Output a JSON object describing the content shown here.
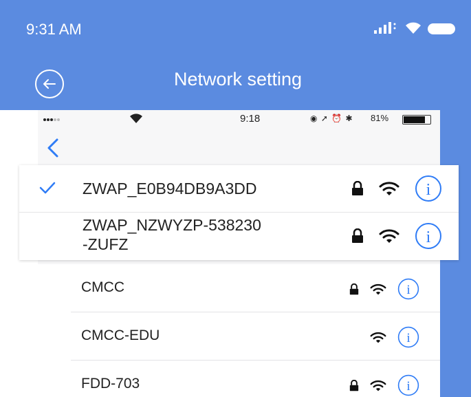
{
  "status_bar": {
    "time": "9:31 AM"
  },
  "header": {
    "title": "Network setting"
  },
  "phone_status": {
    "time": "9:18",
    "battery_percent": "81%",
    "battery_level": 0.81
  },
  "colors": {
    "header_blue": "#5b8be0",
    "ios_blue": "#2f7cf6"
  },
  "selected_networks": [
    {
      "name": "ZWAP_E0B94DB9A3DD",
      "selected": true,
      "locked": true
    },
    {
      "name_lines": [
        "ZWAP_NZWYZP-538230",
        "-ZUFZ"
      ],
      "selected": false,
      "locked": true
    }
  ],
  "networks": [
    {
      "name": "CMCC",
      "locked": true
    },
    {
      "name": "CMCC-EDU",
      "locked": false
    },
    {
      "name": "FDD-703",
      "locked": true
    }
  ]
}
